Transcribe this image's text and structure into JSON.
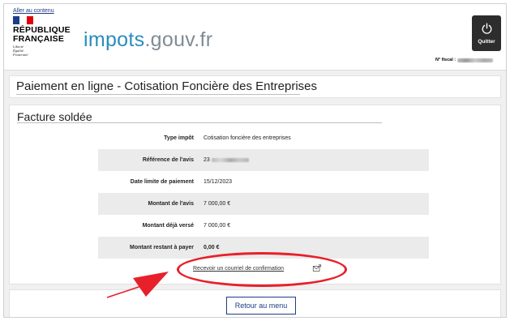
{
  "header": {
    "skip_link": "Aller au contenu",
    "republique_line1": "RÉPUBLIQUE",
    "republique_line2": "FRANÇAISE",
    "devise_1": "Liberté",
    "devise_2": "Égalité",
    "devise_3": "Fraternité",
    "brand_main": "impots",
    "brand_suffix": ".gouv.fr",
    "quit_label": "Quitter",
    "fiscal_label": "N° fiscal :",
    "icons": {
      "quit": "power-icon"
    }
  },
  "title": "Paiement en ligne - Cotisation Foncière des Entreprises",
  "section": {
    "title": "Facture soldée",
    "rows": [
      {
        "label": "Type impôt",
        "value": "Cotisation foncière des entreprises"
      },
      {
        "label": "Référence de l'avis",
        "value": "23"
      },
      {
        "label": "Date limite de paiement",
        "value": "15/12/2023"
      },
      {
        "label": "Montant de l'avis",
        "value": "7 000,00 €"
      },
      {
        "label": "Montant déjà versé",
        "value": "7 000,00 €"
      },
      {
        "label": "Montant restant à payer",
        "value": "0,00 €"
      }
    ],
    "confirm_link": "Recevoir un courriel de confirmation",
    "confirm_icon": "envelope-icon"
  },
  "menu_button": "Retour au menu",
  "colors": {
    "brand_blue": "#2a8cbe",
    "marianne_blue": "#1f3c88",
    "annotation_red": "#e8202a"
  }
}
